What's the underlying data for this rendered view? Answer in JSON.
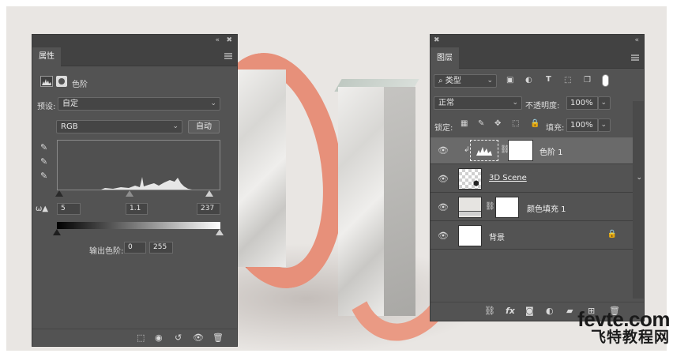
{
  "properties_panel": {
    "collapse_icon": "«",
    "close_icon": "✖",
    "tab_label": "属性",
    "adjustment_name": "色阶",
    "preset_label": "预设:",
    "preset_value": "自定",
    "channel_value": "RGB",
    "auto_button": "自动",
    "input_black": "5",
    "input_gamma": "1.1",
    "input_white": "237",
    "output_label": "输出色阶:",
    "output_black": "0",
    "output_white": "255",
    "chevron": "⌄"
  },
  "layers_panel": {
    "close_icon": "✖",
    "collapse_icon": "«",
    "tab_label": "图层",
    "filter_value": "类型",
    "blend_mode": "正常",
    "opacity_label": "不透明度:",
    "opacity_value": "100%",
    "lock_label": "锁定:",
    "fill_label": "填充:",
    "fill_value": "100%",
    "layers": [
      {
        "name": "色阶 1"
      },
      {
        "name": "3D Scene"
      },
      {
        "name": "颜色填充 1"
      },
      {
        "name": "背景"
      }
    ],
    "fx_label": "fx"
  },
  "watermark": {
    "line1": "fevte.com",
    "line2": "飞特教程网"
  }
}
